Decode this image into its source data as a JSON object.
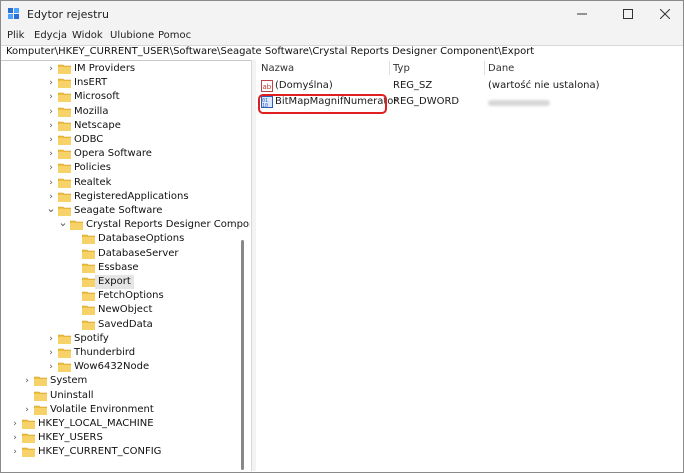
{
  "window": {
    "title": "Edytor rejestru"
  },
  "menu": [
    "Plik",
    "Edycja",
    "Widok",
    "Ulubione",
    "Pomoc"
  ],
  "address": "Komputer\\HKEY_CURRENT_USER\\Software\\Seagate Software\\Crystal Reports Designer Component\\Export",
  "tree": [
    {
      "label": "IM Providers",
      "indent": 2,
      "chev": "right"
    },
    {
      "label": "InsERT",
      "indent": 2,
      "chev": "right"
    },
    {
      "label": "Microsoft",
      "indent": 2,
      "chev": "right"
    },
    {
      "label": "Mozilla",
      "indent": 2,
      "chev": "right"
    },
    {
      "label": "Netscape",
      "indent": 2,
      "chev": "right"
    },
    {
      "label": "ODBC",
      "indent": 2,
      "chev": "right"
    },
    {
      "label": "Opera Software",
      "indent": 2,
      "chev": "right"
    },
    {
      "label": "Policies",
      "indent": 2,
      "chev": "right"
    },
    {
      "label": "Realtek",
      "indent": 2,
      "chev": "right"
    },
    {
      "label": "RegisteredApplications",
      "indent": 2,
      "chev": "right"
    },
    {
      "label": "Seagate Software",
      "indent": 2,
      "chev": "down"
    },
    {
      "label": "Crystal Reports Designer Component",
      "indent": 3,
      "chev": "down"
    },
    {
      "label": "DatabaseOptions",
      "indent": 4,
      "chev": "none"
    },
    {
      "label": "DatabaseServer",
      "indent": 4,
      "chev": "none"
    },
    {
      "label": "Essbase",
      "indent": 4,
      "chev": "none"
    },
    {
      "label": "Export",
      "indent": 4,
      "chev": "none",
      "selected": true
    },
    {
      "label": "FetchOptions",
      "indent": 4,
      "chev": "none"
    },
    {
      "label": "NewObject",
      "indent": 4,
      "chev": "none"
    },
    {
      "label": "SavedData",
      "indent": 4,
      "chev": "none"
    },
    {
      "label": "Spotify",
      "indent": 2,
      "chev": "right"
    },
    {
      "label": "Thunderbird",
      "indent": 2,
      "chev": "right"
    },
    {
      "label": "Wow6432Node",
      "indent": 2,
      "chev": "right"
    },
    {
      "label": "System",
      "indent": 1,
      "chev": "right"
    },
    {
      "label": "Uninstall",
      "indent": 1,
      "chev": "none"
    },
    {
      "label": "Volatile Environment",
      "indent": 1,
      "chev": "right"
    },
    {
      "label": "HKEY_LOCAL_MACHINE",
      "indent": 0,
      "chev": "right"
    },
    {
      "label": "HKEY_USERS",
      "indent": 0,
      "chev": "right"
    },
    {
      "label": "HKEY_CURRENT_CONFIG",
      "indent": 0,
      "chev": "right"
    }
  ],
  "values": {
    "headers": {
      "name": "Nazwa",
      "type": "Typ",
      "data": "Dane"
    },
    "rows": [
      {
        "name": "(Domyślna)",
        "type": "REG_SZ",
        "data": "(wartość nie ustalona)",
        "icon": "string-value-icon"
      },
      {
        "name": "BitMapMagnifNumerator",
        "type": "REG_DWORD",
        "data": "",
        "icon": "binary-value-icon",
        "highlighted": true
      }
    ]
  },
  "colors": {
    "highlight": "#e02020",
    "folder": "#f0c040",
    "selection": "#e5e5e5"
  }
}
